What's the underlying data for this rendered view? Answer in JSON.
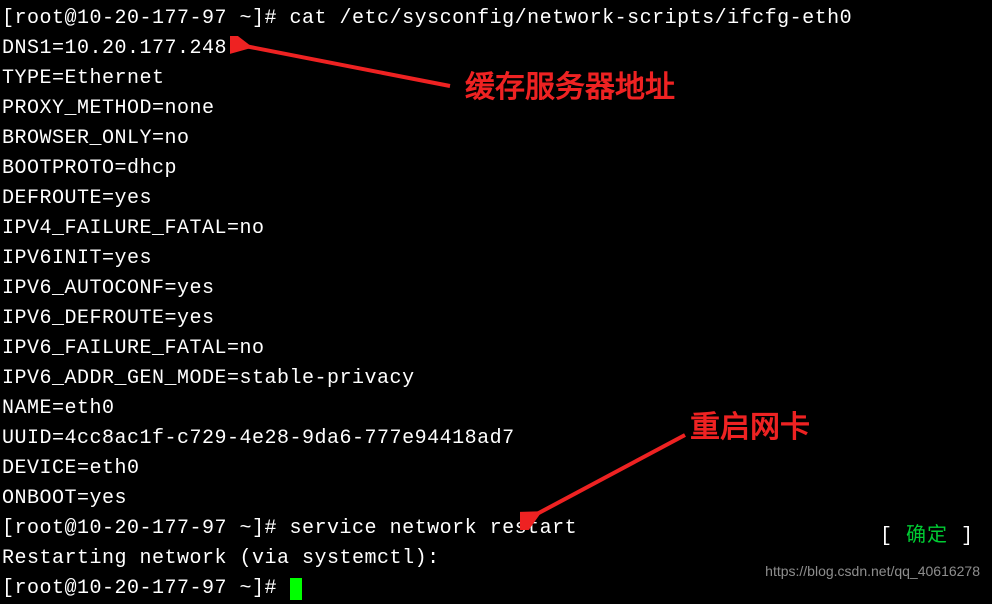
{
  "prompt1": "[root@10-20-177-97 ~]# ",
  "cmd1": "cat /etc/sysconfig/network-scripts/ifcfg-eth0",
  "cfg": {
    "l1": "DNS1=10.20.177.248",
    "l2": "TYPE=Ethernet",
    "l3": "PROXY_METHOD=none",
    "l4": "BROWSER_ONLY=no",
    "l5": "BOOTPROTO=dhcp",
    "l6": "DEFROUTE=yes",
    "l7": "IPV4_FAILURE_FATAL=no",
    "l8": "IPV6INIT=yes",
    "l9": "IPV6_AUTOCONF=yes",
    "l10": "IPV6_DEFROUTE=yes",
    "l11": "IPV6_FAILURE_FATAL=no",
    "l12": "IPV6_ADDR_GEN_MODE=stable-privacy",
    "l13": "NAME=eth0",
    "l14": "UUID=4cc8ac1f-c729-4e28-9da6-777e94418ad7",
    "l15": "DEVICE=eth0",
    "l16": "ONBOOT=yes"
  },
  "prompt2": "[root@10-20-177-97 ~]# ",
  "cmd2": "service network restart",
  "restart_msg": "Restarting network (via systemctl):",
  "status_left": "[  ",
  "status_ok": "确定",
  "status_right": "  ]",
  "prompt3": "[root@10-20-177-97 ~]# ",
  "annotation1": "缓存服务器地址",
  "annotation2": "重启网卡",
  "watermark": "https://blog.csdn.net/qq_40616278",
  "colors": {
    "annotation": "#ee2222",
    "ok": "#00cc33"
  }
}
